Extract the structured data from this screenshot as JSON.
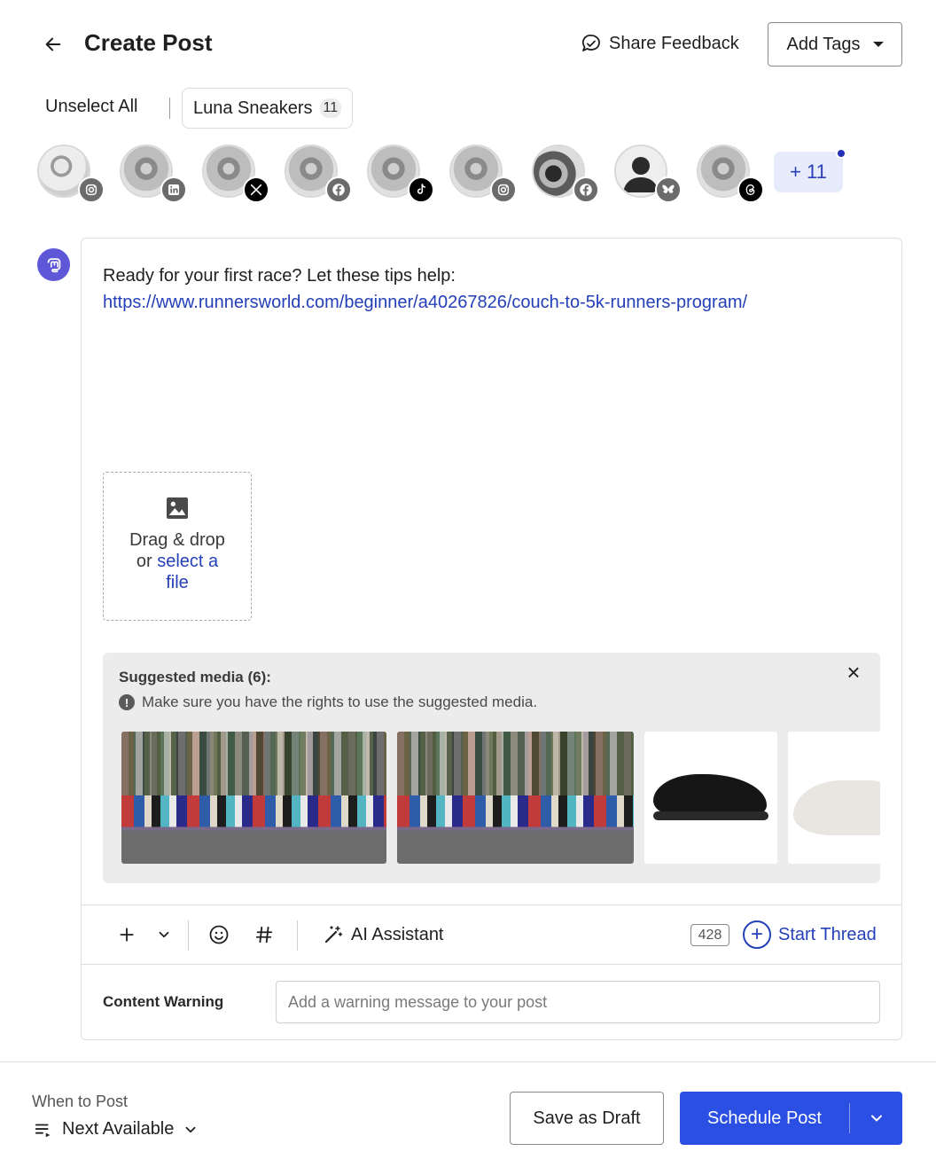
{
  "header": {
    "title": "Create Post",
    "share_feedback": "Share Feedback",
    "add_tags": "Add Tags"
  },
  "groups": {
    "unselect_all": "Unselect All",
    "active_group": {
      "name": "Luna Sneakers",
      "count": "11"
    }
  },
  "accounts": [
    {
      "network": "instagram",
      "photo": "a"
    },
    {
      "network": "linkedin",
      "photo": "c"
    },
    {
      "network": "x",
      "photo": "c"
    },
    {
      "network": "facebook",
      "photo": "c"
    },
    {
      "network": "tiktok",
      "photo": "c"
    },
    {
      "network": "instagram",
      "photo": "c"
    },
    {
      "network": "facebook",
      "photo": "b"
    },
    {
      "network": "bluesky",
      "photo": "person"
    },
    {
      "network": "threads",
      "photo": "c"
    }
  ],
  "more_accounts": "+ 11",
  "composer": {
    "network_icon": "mastodon-icon",
    "text_line": "Ready for your first race? Let these tips help:",
    "link": "https://www.runnersworld.com/beginner/a40267826/couch-to-5k-runners-program/",
    "dropzone": {
      "line1": "Drag & drop",
      "line2_prefix": "or ",
      "line2_link": "select a",
      "line3_link": "file"
    },
    "suggested": {
      "title": "Suggested media (6):",
      "note": "Make sure you have the rights to use the suggested media."
    },
    "toolbar": {
      "ai_assistant": "AI Assistant",
      "char_count": "428",
      "start_thread": "Start Thread"
    },
    "content_warning": {
      "label": "Content Warning",
      "placeholder": "Add a warning message to your post"
    }
  },
  "footer": {
    "when_label": "When to Post",
    "when_value": "Next Available",
    "save_draft": "Save as Draft",
    "schedule": "Schedule Post"
  },
  "colors": {
    "accent": "#2a4fe2",
    "link": "#2440b8",
    "mastodon": "#5e58d8"
  }
}
